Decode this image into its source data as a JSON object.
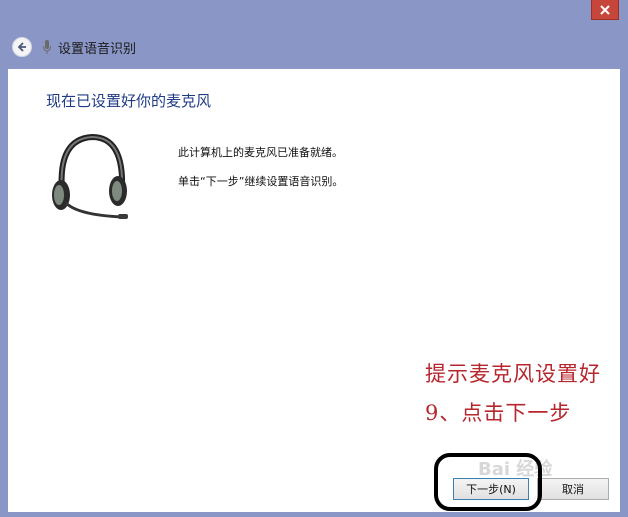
{
  "window": {
    "title": "设置语音识别",
    "close_label": "✕"
  },
  "page": {
    "heading": "现在已设置好你的麦克风",
    "message_1": "此计算机上的麦克风已准备就绪。",
    "message_2": "单击“下一步”继续设置语音识别。"
  },
  "annotation": {
    "line_1": "提示麦克风设置好",
    "line_2": "9、点击下一步"
  },
  "buttons": {
    "next": "下一步(N)",
    "cancel": "取消"
  },
  "watermark": "Bai 经验"
}
